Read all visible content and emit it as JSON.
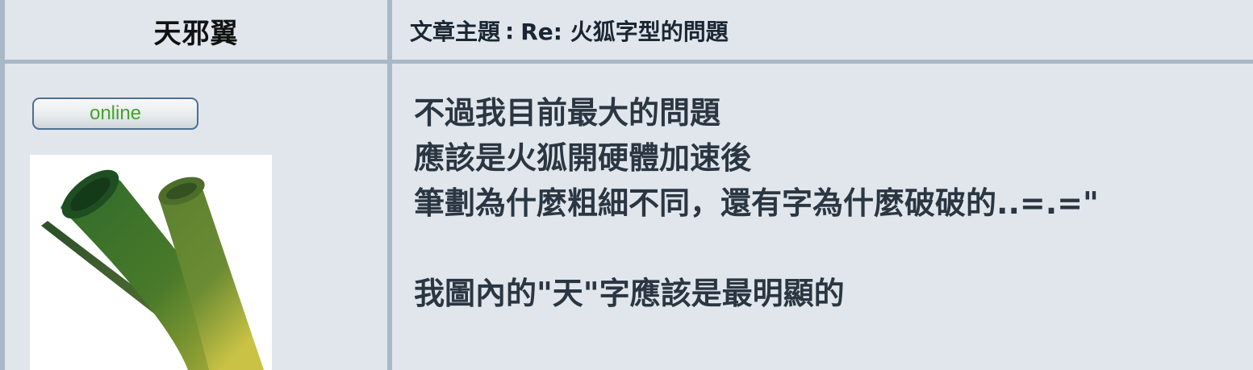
{
  "post": {
    "author": "天邪翼",
    "subject_label": "文章主題",
    "subject_sep": ":",
    "subject": "Re: 火狐字型的問題",
    "status_badge": "online",
    "body_lines": [
      "不過我目前最大的問題",
      "應該是火狐開硬體加速後",
      "筆劃為什麼粗細不同，還有字為什麼破破的..=.=\"",
      "",
      "我圖內的\"天\"字應該是最明顯的"
    ]
  },
  "colors": {
    "background": "#e1e6ec",
    "border": "#a9b8c7",
    "online_text": "#47a22a"
  },
  "icons": {
    "avatar": "green-onion-avatar"
  }
}
